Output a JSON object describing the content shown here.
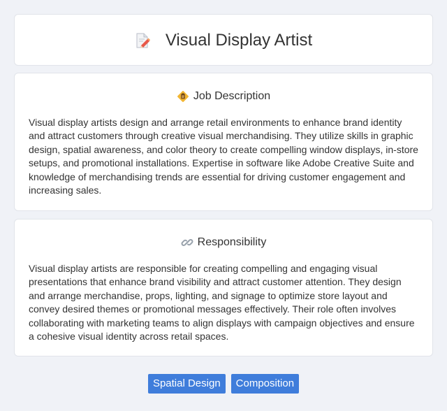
{
  "header": {
    "title": "Visual Display Artist",
    "icon": "document-pencil-icon"
  },
  "job_description": {
    "icon": "clipboard-badge-icon",
    "title": "Job Description",
    "text": "Visual display artists design and arrange retail environments to enhance brand identity and attract customers through creative visual merchandising. They utilize skills in graphic design, spatial awareness, and color theory to create compelling window displays, in-store setups, and promotional installations. Expertise in software like Adobe Creative Suite and knowledge of merchandising trends are essential for driving customer engagement and increasing sales."
  },
  "responsibility": {
    "icon": "link-icon",
    "title": "Responsibility",
    "text": "Visual display artists are responsible for creating compelling and engaging visual presentations that enhance brand visibility and attract customer attention. They design and arrange merchandise, props, lighting, and signage to optimize store layout and convey desired themes or promotional messages effectively. Their role often involves collaborating with marketing teams to align displays with campaign objectives and ensure a cohesive visual identity across retail spaces."
  },
  "tags": [
    "Spatial Design",
    "Composition"
  ],
  "colors": {
    "background": "#f0f2f7",
    "card": "#ffffff",
    "tag": "#3f7ddb",
    "text": "#333333"
  }
}
